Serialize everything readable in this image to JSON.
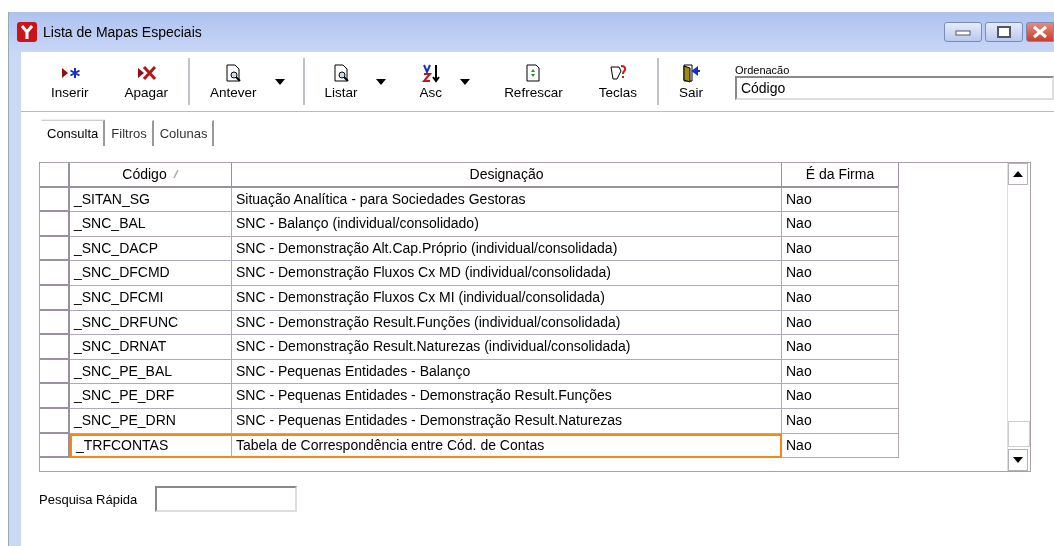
{
  "window": {
    "title": "Lista de Mapas Especiais"
  },
  "toolbar": {
    "buttons": [
      {
        "label": "Inserir",
        "has_menu": false,
        "separator_after": false
      },
      {
        "label": "Apagar",
        "has_menu": false,
        "separator_after": true
      },
      {
        "label": "Antever",
        "has_menu": true,
        "separator_after": true
      },
      {
        "label": "Listar",
        "has_menu": true,
        "separator_after": false
      },
      {
        "label": "Asc",
        "has_menu": true,
        "separator_after": false
      },
      {
        "label": "Refrescar",
        "has_menu": false,
        "separator_after": false
      },
      {
        "label": "Teclas",
        "has_menu": false,
        "separator_after": true
      },
      {
        "label": "Sair",
        "has_menu": false,
        "separator_after": false
      }
    ],
    "ordering": {
      "label": "Ordenacão",
      "value": "Código"
    }
  },
  "tabs": [
    {
      "label": "Consulta",
      "selected": true
    },
    {
      "label": "Filtros",
      "selected": false
    },
    {
      "label": "Colunas",
      "selected": false
    }
  ],
  "table": {
    "columns": [
      {
        "label": "Código",
        "sorted": true
      },
      {
        "label": "Designação",
        "sorted": false
      },
      {
        "label": "É da Firma",
        "sorted": false
      }
    ],
    "rows": [
      {
        "cells": [
          "_SITAN_SG",
          "Situação Analítica - para Sociedades Gestoras",
          "Nao"
        ],
        "highlighted": false
      },
      {
        "cells": [
          "_SNC_BAL",
          "SNC - Balanço (individual/consolidado)",
          "Nao"
        ],
        "highlighted": false
      },
      {
        "cells": [
          "_SNC_DACP",
          "SNC - Demonstração Alt.Cap.Próprio (individual/consolidada)",
          "Nao"
        ],
        "highlighted": false
      },
      {
        "cells": [
          "_SNC_DFCMD",
          "SNC - Demonstração Fluxos Cx MD (individual/consolidada)",
          "Nao"
        ],
        "highlighted": false
      },
      {
        "cells": [
          "_SNC_DFCMI",
          "SNC - Demonstração Fluxos Cx MI (individual/consolidada)",
          "Nao"
        ],
        "highlighted": false
      },
      {
        "cells": [
          "_SNC_DRFUNC",
          "SNC - Demonstração Result.Funções (individual/consolidada)",
          "Nao"
        ],
        "highlighted": false
      },
      {
        "cells": [
          "_SNC_DRNAT",
          "SNC - Demonstração Result.Naturezas (individual/consolidada)",
          "Nao"
        ],
        "highlighted": false
      },
      {
        "cells": [
          "_SNC_PE_BAL",
          "SNC - Pequenas Entidades - Balanço",
          "Nao"
        ],
        "highlighted": false
      },
      {
        "cells": [
          "_SNC_PE_DRF",
          "SNC - Pequenas Entidades - Demonstração Result.Funções",
          "Nao"
        ],
        "highlighted": false
      },
      {
        "cells": [
          "_SNC_PE_DRN",
          "SNC - Pequenas Entidades - Demonstração Result.Naturezas",
          "Nao"
        ],
        "highlighted": false
      },
      {
        "cells": [
          "_TRFCONTAS",
          "Tabela de Correspondência entre Cód. de Contas",
          "Nao"
        ],
        "highlighted": true
      }
    ]
  },
  "quick_search": {
    "label": "Pesquisa Rápida"
  }
}
